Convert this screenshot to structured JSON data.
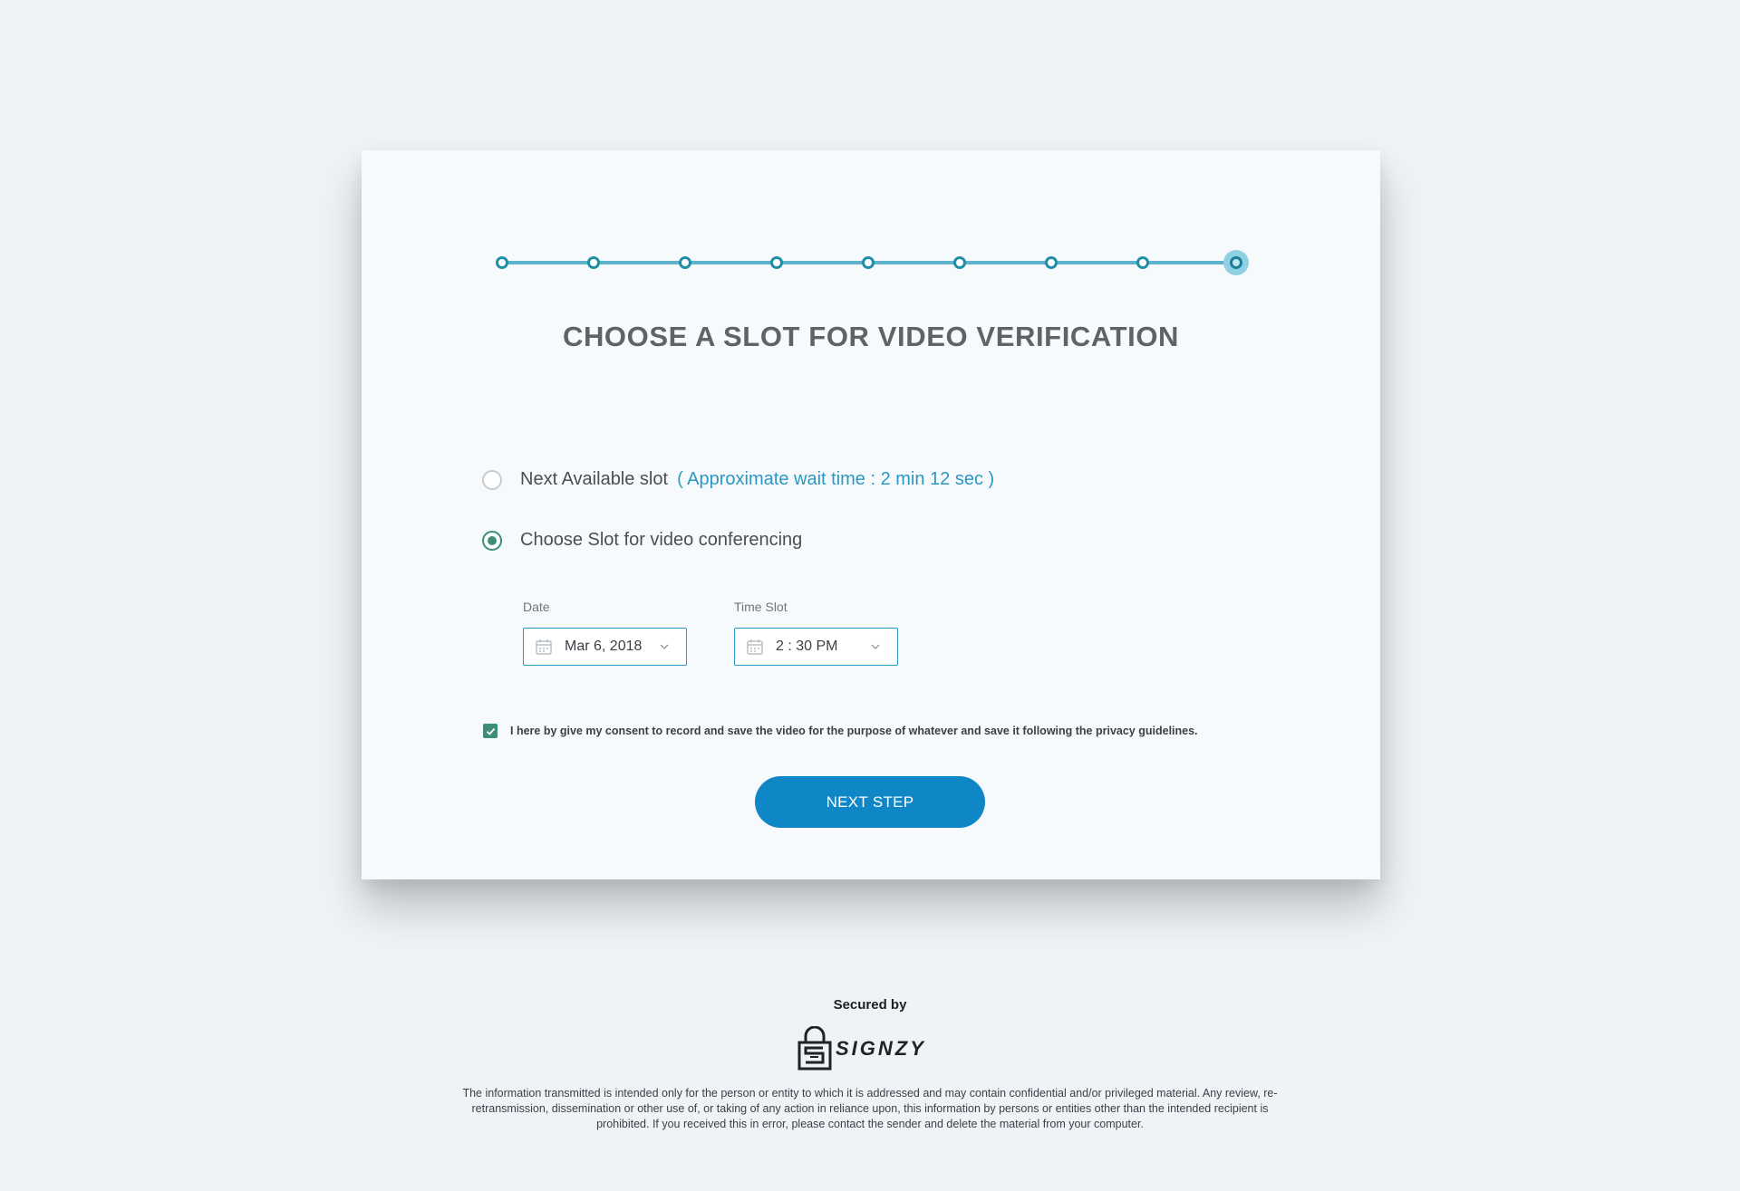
{
  "stepper": {
    "total_steps": 9,
    "current_step": 9,
    "line_color": "#5cb3cb"
  },
  "page": {
    "title": "CHOOSE A SLOT FOR VIDEO VERIFICATION"
  },
  "options": {
    "next_available_label": "Next Available slot",
    "wait_time_text": "( Approximate wait time : 2 min 12 sec )",
    "choose_slot_label": "Choose Slot for video conferencing",
    "selected": "choose_slot"
  },
  "fields": {
    "date_label": "Date",
    "date_value": "Mar 6, 2018",
    "time_label": "Time Slot",
    "time_value": "2 : 30 PM",
    "date_icon": "calendar-icon",
    "dropdown_icon": "chevron-down-icon"
  },
  "consent": {
    "checked": true,
    "text": "I here by give my consent to record and save the video for the purpose of whatever and save it following the privacy guidelines."
  },
  "actions": {
    "next_label": "NEXT STEP",
    "primary_color": "#0f86c6"
  },
  "footer": {
    "secured_by": "Secured by",
    "brand": "SIGNZY",
    "disclaimer": "The information transmitted is intended only for the person or entity to which it is addressed and may contain confidential and/or privileged material. Any review, re-retransmission, dissemination or other use of, or taking of any action in reliance upon, this information by persons or entities other than the intended recipient is prohibited. If you received this in error, please contact the sender and delete the material from your computer."
  },
  "colors": {
    "accent_green": "#3c8f74",
    "link_blue": "#2b98c4",
    "background": "#eef3f7"
  }
}
